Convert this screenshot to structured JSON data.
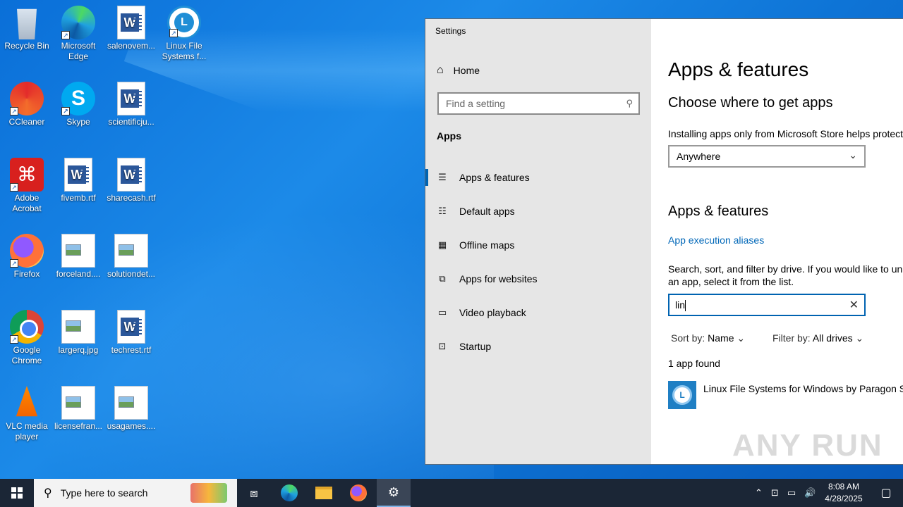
{
  "desktop": {
    "icons": [
      {
        "label": "Recycle Bin"
      },
      {
        "label": "Microsoft Edge"
      },
      {
        "label": "salenovem..."
      },
      {
        "label": "Linux File Systems f..."
      },
      {
        "label": "CCleaner"
      },
      {
        "label": "Skype"
      },
      {
        "label": "scientificju..."
      },
      {
        "label": "Adobe Acrobat"
      },
      {
        "label": "fivemb.rtf"
      },
      {
        "label": "sharecash.rtf"
      },
      {
        "label": "Firefox"
      },
      {
        "label": "forceland...."
      },
      {
        "label": "solutiondet..."
      },
      {
        "label": "Google Chrome"
      },
      {
        "label": "largerq.jpg"
      },
      {
        "label": "techrest.rtf"
      },
      {
        "label": "VLC media player"
      },
      {
        "label": "licensefran..."
      },
      {
        "label": "usagames...."
      }
    ]
  },
  "settings": {
    "window_title": "Settings",
    "home_label": "Home",
    "search_placeholder": "Find a setting",
    "section_title": "Apps",
    "nav_items": [
      {
        "label": "Apps & features",
        "icon": "list-icon",
        "active": true
      },
      {
        "label": "Default apps",
        "icon": "default-apps-icon"
      },
      {
        "label": "Offline maps",
        "icon": "map-icon"
      },
      {
        "label": "Apps for websites",
        "icon": "web-link-icon"
      },
      {
        "label": "Video playback",
        "icon": "video-icon"
      },
      {
        "label": "Startup",
        "icon": "startup-icon"
      }
    ],
    "page_title": "Apps & features",
    "choose_heading": "Choose where to get apps",
    "choose_desc": "Installing apps only from Microsoft Store helps protect",
    "source_dropdown_value": "Anywhere",
    "features_heading": "Apps & features",
    "aliases_link": "App execution aliases",
    "search_desc_line1": "Search, sort, and filter by drive. If you would like to un",
    "search_desc_line2": "an app, select it from the list.",
    "filter_value": "lin",
    "sort_label": "Sort by:",
    "sort_value": "Name",
    "filter_label": "Filter by:",
    "filter_drive": "All drives",
    "result_count": "1 app found",
    "app_name": "Linux File Systems for Windows by Paragon Sc",
    "accent_color": "#0063b1",
    "link_color": "#0067b8"
  },
  "taskbar": {
    "search_placeholder": "Type here to search",
    "time": "8:08 AM",
    "date": "4/28/2025"
  },
  "watermark": "ANY RUN"
}
